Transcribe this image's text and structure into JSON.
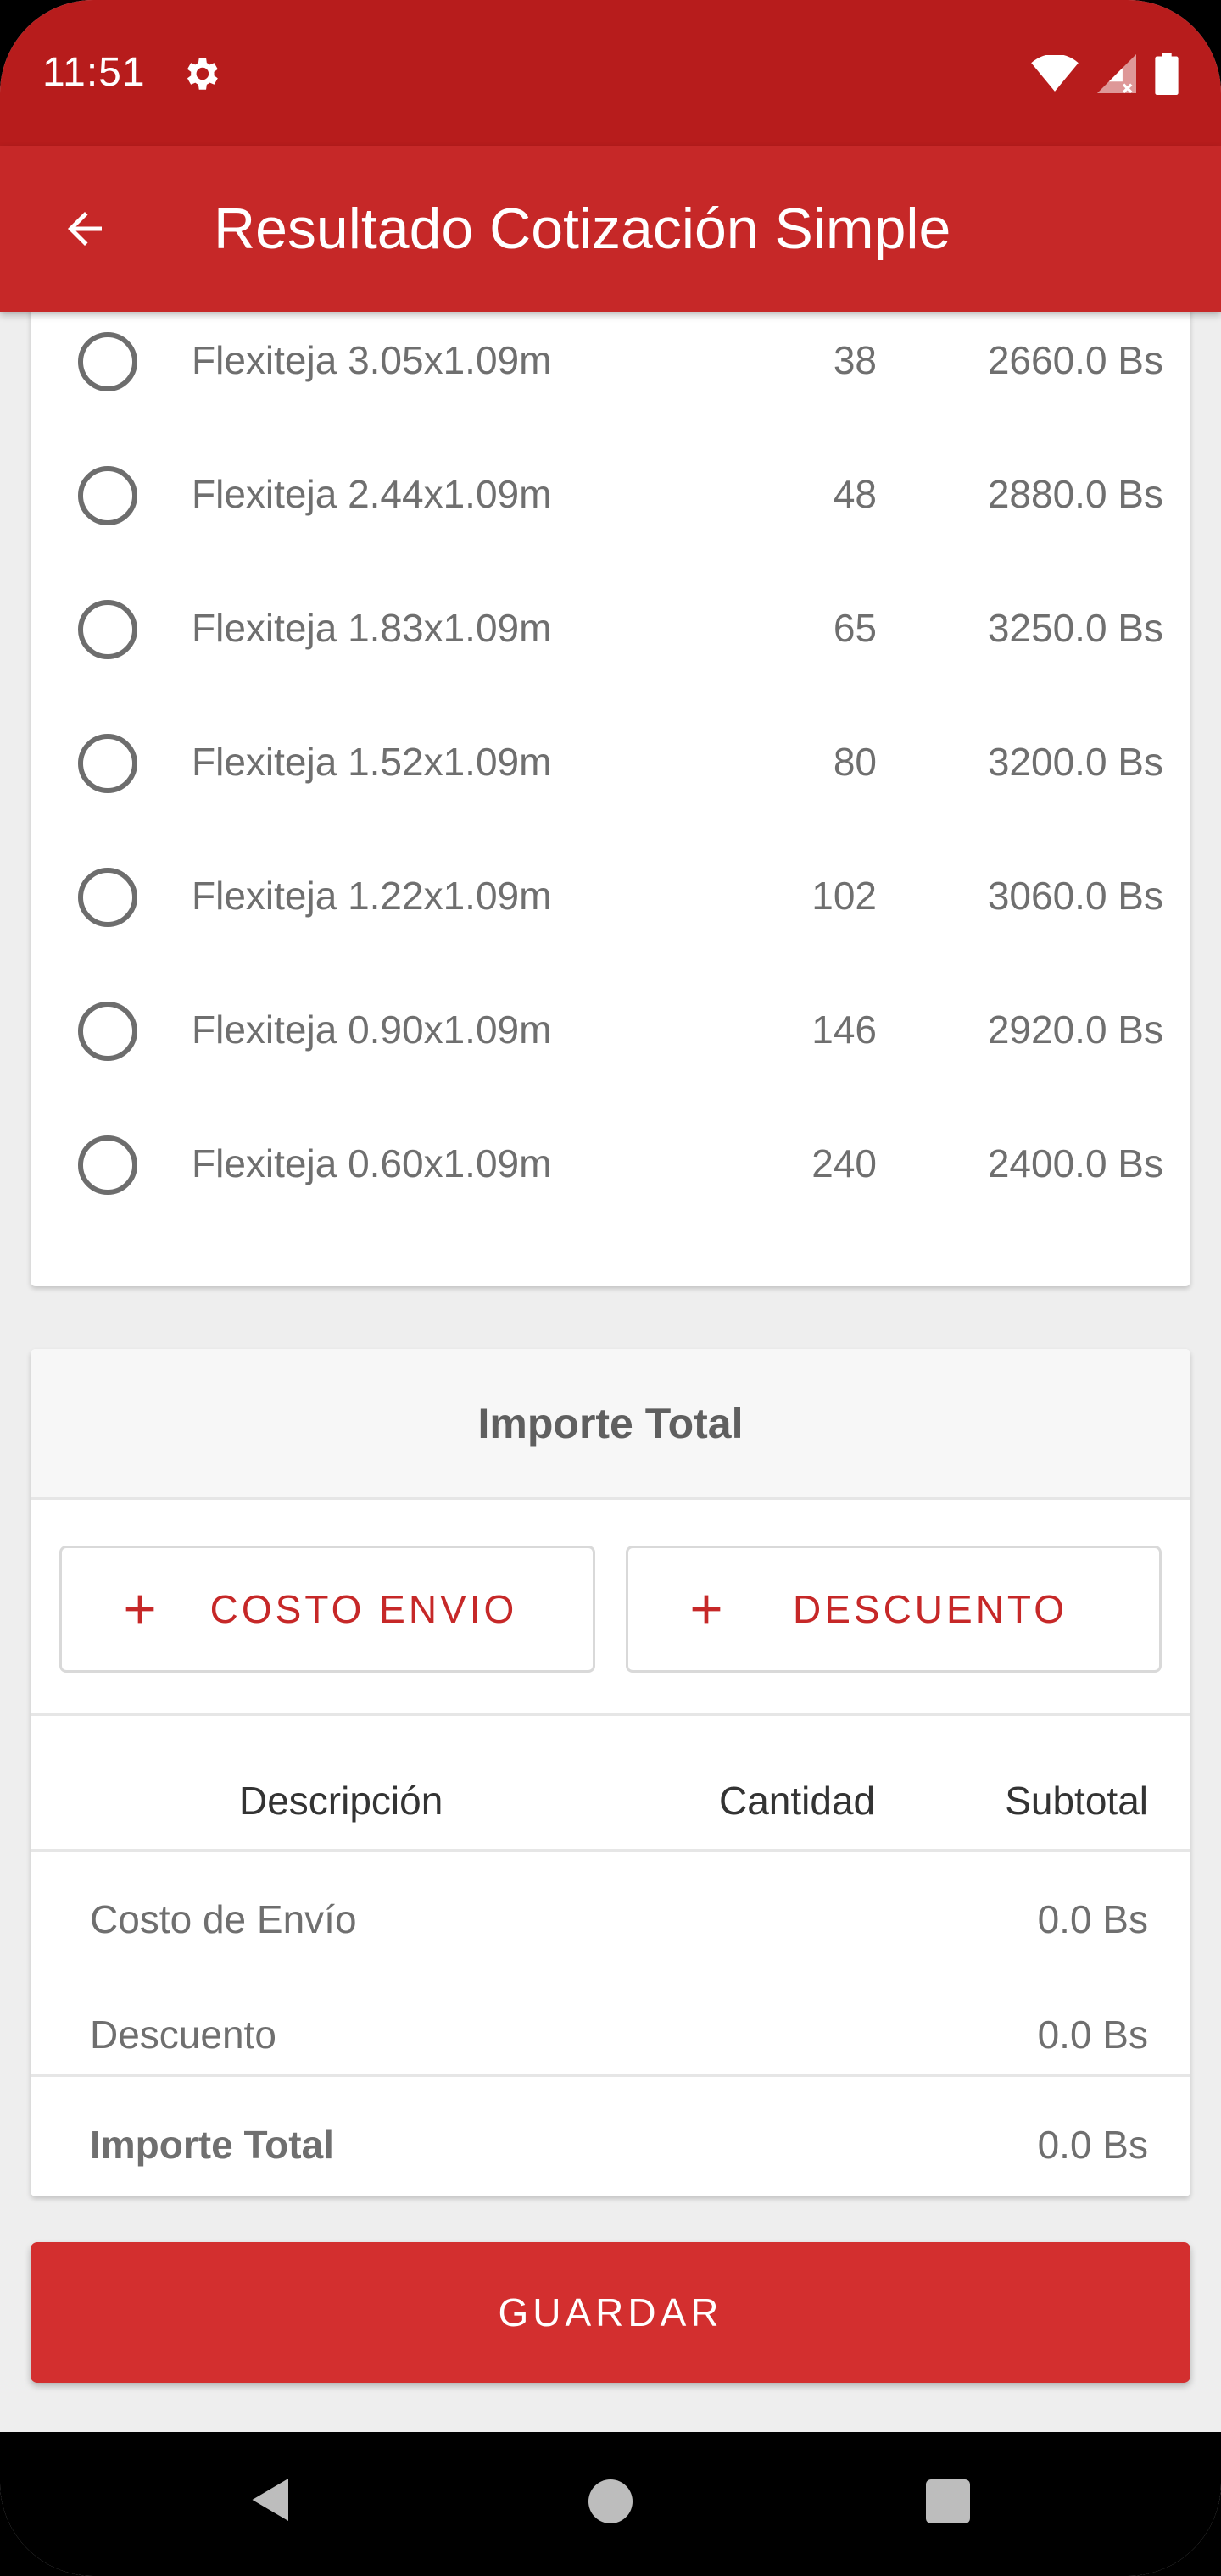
{
  "status_bar": {
    "time": "11:51"
  },
  "app_bar": {
    "title": "Resultado Cotización Simple"
  },
  "options": [
    {
      "name": "Flexiteja 3.05x1.09m",
      "qty": "38",
      "price": "2660.0 Bs"
    },
    {
      "name": "Flexiteja 2.44x1.09m",
      "qty": "48",
      "price": "2880.0 Bs"
    },
    {
      "name": "Flexiteja 1.83x1.09m",
      "qty": "65",
      "price": "3250.0 Bs"
    },
    {
      "name": "Flexiteja 1.52x1.09m",
      "qty": "80",
      "price": "3200.0 Bs"
    },
    {
      "name": "Flexiteja 1.22x1.09m",
      "qty": "102",
      "price": "3060.0 Bs"
    },
    {
      "name": "Flexiteja 0.90x1.09m",
      "qty": "146",
      "price": "2920.0 Bs"
    },
    {
      "name": "Flexiteja 0.60x1.09m",
      "qty": "240",
      "price": "2400.0 Bs"
    }
  ],
  "total_card": {
    "header": "Importe Total",
    "btn_envio": "COSTO ENVIO",
    "btn_descuento": "DESCUENTO",
    "columns": {
      "descripcion": "Descripción",
      "cantidad": "Cantidad",
      "subtotal": "Subtotal"
    },
    "rows": [
      {
        "label": "Costo de Envío",
        "value": "0.0 Bs"
      },
      {
        "label": "Descuento",
        "value": "0.0 Bs"
      }
    ],
    "total": {
      "label": "Importe Total",
      "value": "0.0 Bs"
    }
  },
  "save_button": "GUARDAR",
  "colors": {
    "status_bar": "#b71c1c",
    "app_bar": "#c62828",
    "accent": "#d32f2f"
  }
}
